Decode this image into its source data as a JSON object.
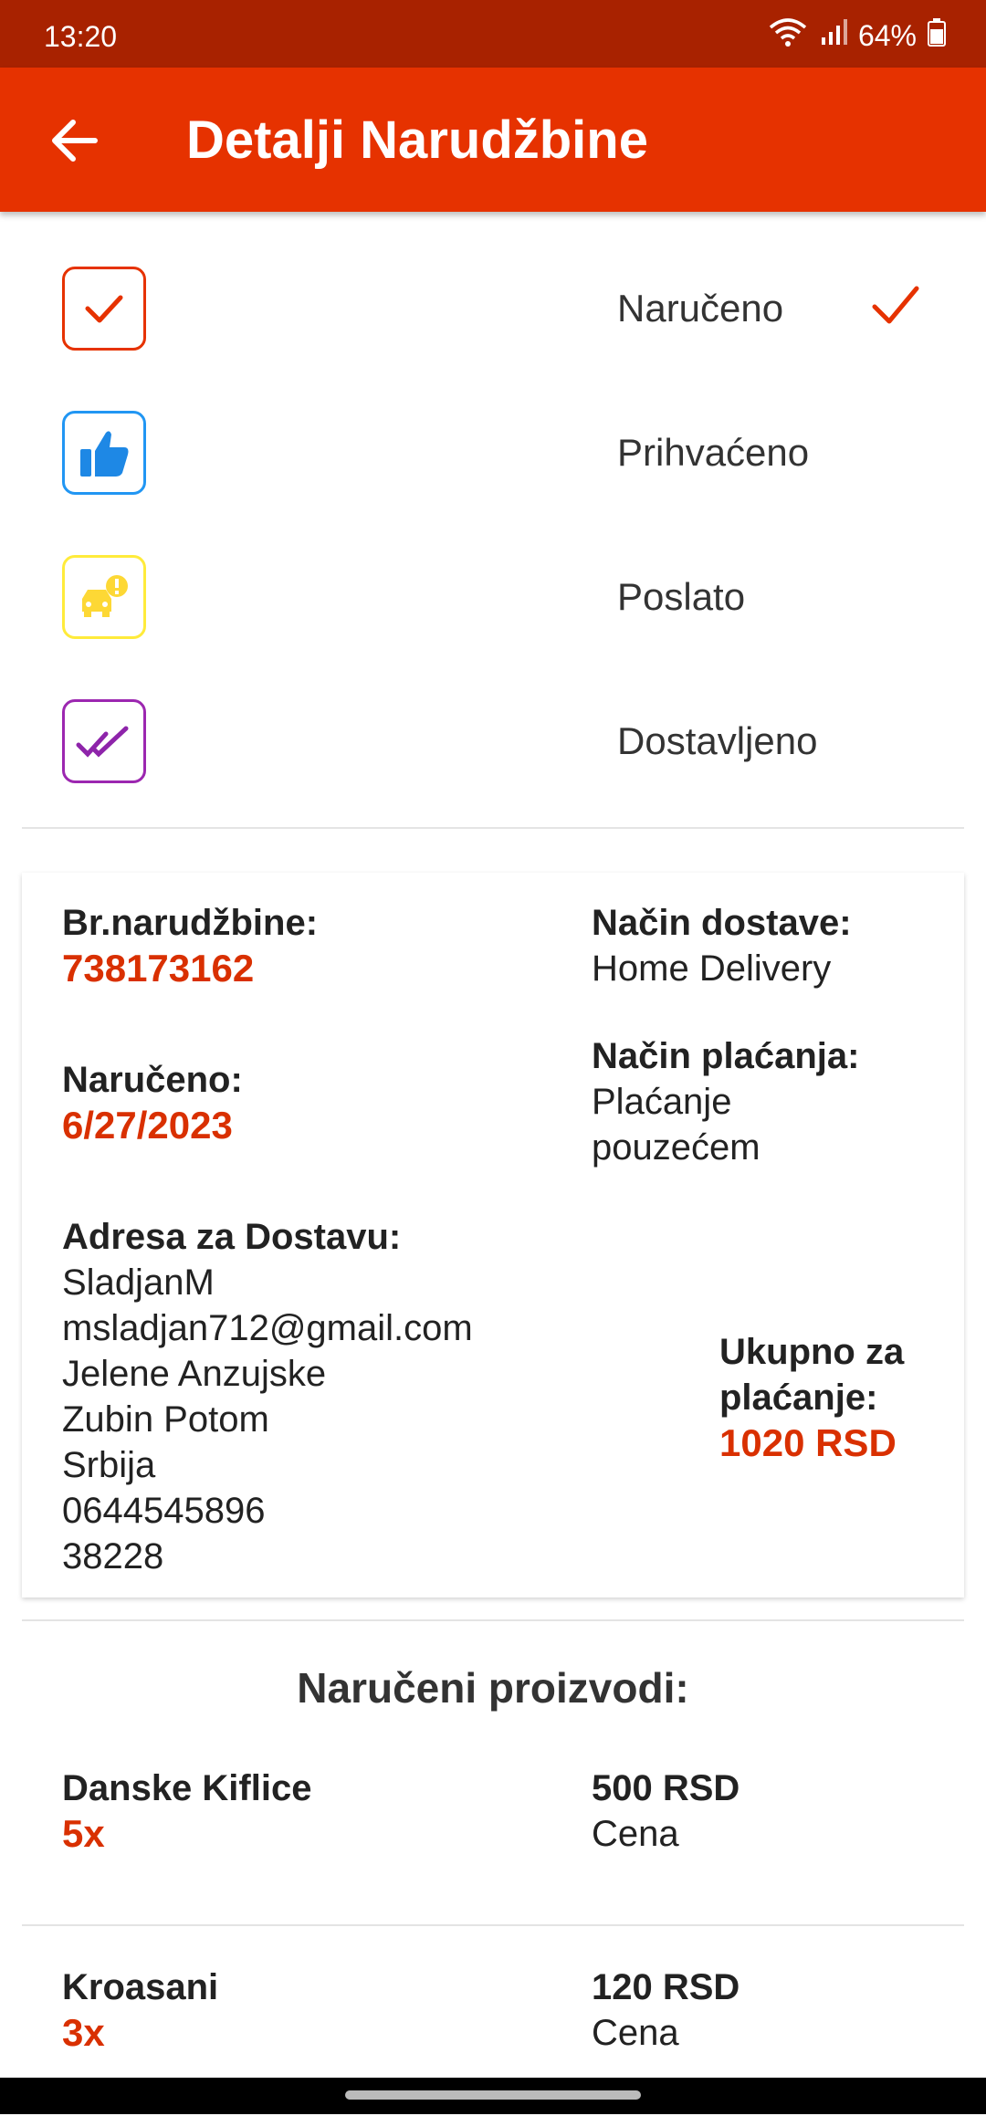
{
  "status_bar": {
    "time": "13:20",
    "battery": "64%"
  },
  "app_bar": {
    "title": "Detalji Narudžbine",
    "back_icon": "arrow-left-icon"
  },
  "statuses": [
    {
      "label": "Naručeno",
      "icon": "checkbox-check-icon",
      "color": "#e63200",
      "done": true
    },
    {
      "label": "Prihvaćeno",
      "icon": "thumbs-up-icon",
      "color": "#2196f3",
      "done": false
    },
    {
      "label": "Poslato",
      "icon": "car-alert-icon",
      "color": "#ffeb3b",
      "done": false
    },
    {
      "label": "Dostavljeno",
      "icon": "double-check-icon",
      "color": "#9c27b0",
      "done": false
    }
  ],
  "order": {
    "number_label": "Br.narudžbine:",
    "number": "738173162",
    "delivery_method_label": "Način dostave:",
    "delivery_method": "Home Delivery",
    "ordered_label": "Naručeno:",
    "ordered_date": "6/27/2023",
    "payment_method_label": "Način plaćanja:",
    "payment_method_line1": "Plaćanje",
    "payment_method_line2": "pouzećem",
    "address_label": "Adresa za Dostavu:",
    "address_lines": [
      "SladjanM",
      "msladjan712@gmail.com",
      "Jelene Anzujske",
      "Zubin Potom",
      "Srbija",
      "0644545896",
      "38228"
    ],
    "total_label_line1": "Ukupno za",
    "total_label_line2": "plaćanje:",
    "total": "1020 RSD"
  },
  "products_title": "Naručeni proizvodi:",
  "products": [
    {
      "name": "Danske Kiflice",
      "qty": "5x",
      "price": "500 RSD",
      "price_label": "Cena"
    },
    {
      "name": "Kroasani",
      "qty": "3x",
      "price": "120 RSD",
      "price_label": "Cena"
    }
  ],
  "colors": {
    "primary": "#e63200",
    "status_bar": "#a82200",
    "accent_text": "#d93000"
  }
}
